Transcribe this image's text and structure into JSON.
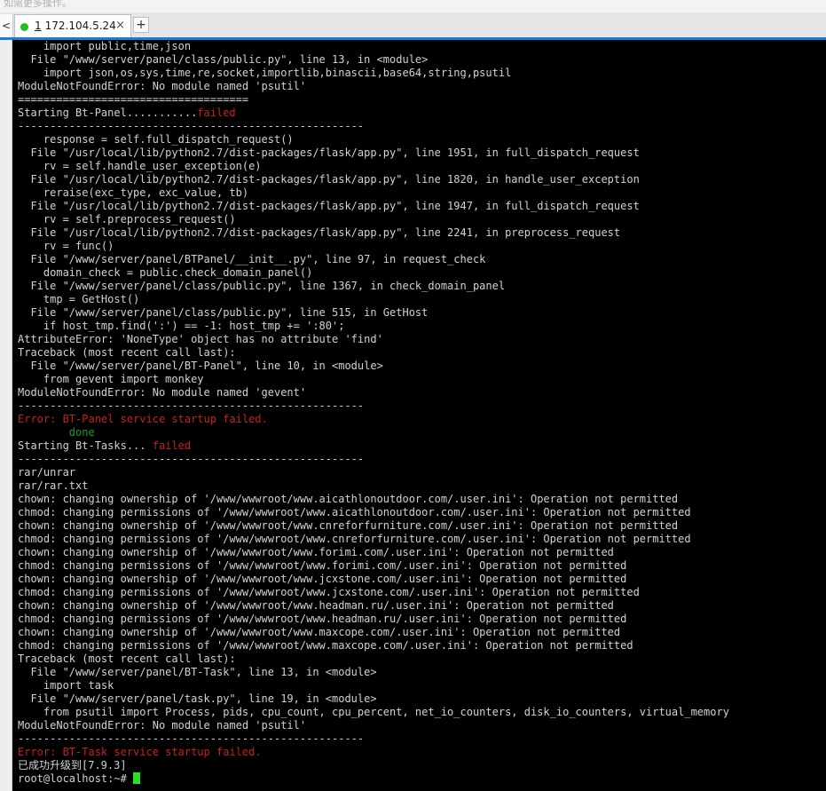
{
  "top_strip_text": "如需更多操作。",
  "tabs": [
    {
      "index": "1",
      "title": "172.104.5.24",
      "close": "×",
      "status_color": "#1ec11e"
    }
  ],
  "new_tab_label": "+",
  "nav_left_label": "<",
  "terminal": {
    "lines": [
      [
        {
          "t": "    import public,time,json"
        }
      ],
      [
        {
          "t": "  File \"/www/server/panel/class/public.py\", line 13, in <module>"
        }
      ],
      [
        {
          "t": "    import json,os,sys,time,re,socket,importlib,binascii,base64,string,psutil"
        }
      ],
      [
        {
          "t": "ModuleNotFoundError: No module named 'psutil'"
        }
      ],
      [
        {
          "t": "===================================="
        }
      ],
      [
        {
          "t": "Starting Bt-Panel..........."
        },
        {
          "t": "failed",
          "c": "red"
        }
      ],
      [
        {
          "t": "------------------------------------------------------"
        }
      ],
      [
        {
          "t": "    response = self.full_dispatch_request()"
        }
      ],
      [
        {
          "t": "  File \"/usr/local/lib/python2.7/dist-packages/flask/app.py\", line 1951, in full_dispatch_request"
        }
      ],
      [
        {
          "t": "    rv = self.handle_user_exception(e)"
        }
      ],
      [
        {
          "t": "  File \"/usr/local/lib/python2.7/dist-packages/flask/app.py\", line 1820, in handle_user_exception"
        }
      ],
      [
        {
          "t": "    reraise(exc_type, exc_value, tb)"
        }
      ],
      [
        {
          "t": "  File \"/usr/local/lib/python2.7/dist-packages/flask/app.py\", line 1947, in full_dispatch_request"
        }
      ],
      [
        {
          "t": "    rv = self.preprocess_request()"
        }
      ],
      [
        {
          "t": "  File \"/usr/local/lib/python2.7/dist-packages/flask/app.py\", line 2241, in preprocess_request"
        }
      ],
      [
        {
          "t": "    rv = func()"
        }
      ],
      [
        {
          "t": "  File \"/www/server/panel/BTPanel/__init__.py\", line 97, in request_check"
        }
      ],
      [
        {
          "t": "    domain_check = public.check_domain_panel()"
        }
      ],
      [
        {
          "t": "  File \"/www/server/panel/class/public.py\", line 1367, in check_domain_panel"
        }
      ],
      [
        {
          "t": "    tmp = GetHost()"
        }
      ],
      [
        {
          "t": "  File \"/www/server/panel/class/public.py\", line 515, in GetHost"
        }
      ],
      [
        {
          "t": "    if host_tmp.find(':') == -1: host_tmp += ':80';"
        }
      ],
      [
        {
          "t": "AttributeError: 'NoneType' object has no attribute 'find'"
        }
      ],
      [
        {
          "t": "Traceback (most recent call last):"
        }
      ],
      [
        {
          "t": "  File \"/www/server/panel/BT-Panel\", line 10, in <module>"
        }
      ],
      [
        {
          "t": "    from gevent import monkey"
        }
      ],
      [
        {
          "t": "ModuleNotFoundError: No module named 'gevent'"
        }
      ],
      [
        {
          "t": "------------------------------------------------------"
        }
      ],
      [
        {
          "t": "Error: BT-Panel service startup failed.",
          "c": "red"
        }
      ],
      [
        {
          "t": "        done",
          "c": "green"
        }
      ],
      [
        {
          "t": "Starting Bt-Tasks... "
        },
        {
          "t": "failed",
          "c": "red"
        }
      ],
      [
        {
          "t": "------------------------------------------------------"
        }
      ],
      [
        {
          "t": "rar/unrar"
        }
      ],
      [
        {
          "t": "rar/rar.txt"
        }
      ],
      [
        {
          "t": "chown: changing ownership of '/www/wwwroot/www.aicathlonoutdoor.com/.user.ini': Operation not permitted"
        }
      ],
      [
        {
          "t": "chmod: changing permissions of '/www/wwwroot/www.aicathlonoutdoor.com/.user.ini': Operation not permitted"
        }
      ],
      [
        {
          "t": "chown: changing ownership of '/www/wwwroot/www.cnreforfurniture.com/.user.ini': Operation not permitted"
        }
      ],
      [
        {
          "t": "chmod: changing permissions of '/www/wwwroot/www.cnreforfurniture.com/.user.ini': Operation not permitted"
        }
      ],
      [
        {
          "t": "chown: changing ownership of '/www/wwwroot/www.forimi.com/.user.ini': Operation not permitted"
        }
      ],
      [
        {
          "t": "chmod: changing permissions of '/www/wwwroot/www.forimi.com/.user.ini': Operation not permitted"
        }
      ],
      [
        {
          "t": "chown: changing ownership of '/www/wwwroot/www.jcxstone.com/.user.ini': Operation not permitted"
        }
      ],
      [
        {
          "t": "chmod: changing permissions of '/www/wwwroot/www.jcxstone.com/.user.ini': Operation not permitted"
        }
      ],
      [
        {
          "t": "chown: changing ownership of '/www/wwwroot/www.headman.ru/.user.ini': Operation not permitted"
        }
      ],
      [
        {
          "t": "chmod: changing permissions of '/www/wwwroot/www.headman.ru/.user.ini': Operation not permitted"
        }
      ],
      [
        {
          "t": "chown: changing ownership of '/www/wwwroot/www.maxcope.com/.user.ini': Operation not permitted"
        }
      ],
      [
        {
          "t": "chmod: changing permissions of '/www/wwwroot/www.maxcope.com/.user.ini': Operation not permitted"
        }
      ],
      [
        {
          "t": "Traceback (most recent call last):"
        }
      ],
      [
        {
          "t": "  File \"/www/server/panel/BT-Task\", line 13, in <module>"
        }
      ],
      [
        {
          "t": "    import task"
        }
      ],
      [
        {
          "t": "  File \"/www/server/panel/task.py\", line 19, in <module>"
        }
      ],
      [
        {
          "t": "    from psutil import Process, pids, cpu_count, cpu_percent, net_io_counters, disk_io_counters, virtual_memory"
        }
      ],
      [
        {
          "t": "ModuleNotFoundError: No module named 'psutil'"
        }
      ],
      [
        {
          "t": "------------------------------------------------------"
        }
      ],
      [
        {
          "t": "Error: BT-Task service startup failed.",
          "c": "red"
        }
      ],
      [
        {
          "t": "已成功升级到[7.9.3]"
        }
      ],
      [
        {
          "t": "root@localhost:~# "
        }
      ]
    ]
  },
  "colors": {
    "terminal_bg": "#000000",
    "terminal_fg": "#d2d2d2",
    "error_red": "#c71f1f",
    "ok_green": "#1f9a1f",
    "cursor": "#27e027",
    "tab_accent": "#1f7ad6"
  }
}
